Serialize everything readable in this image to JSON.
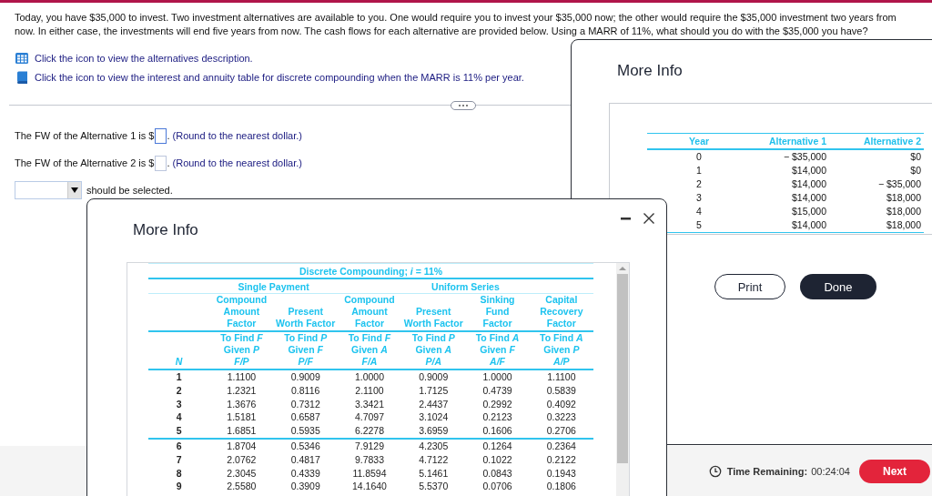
{
  "question": "Today, you have $35,000 to invest. Two investment alternatives are available to you. One would require you to invest your $35,000 now; the other would require the $35,000 investment two years from now. In either case, the investments will end five years from now. The cash flows for each alternative are provided below. Using a MARR of 11%, what should you do with the $35,000 you have?",
  "links": [
    {
      "kind": "table",
      "text": "Click the icon to view the alternatives description."
    },
    {
      "kind": "book",
      "text": "Click the icon to view the interest and annuity table for discrete compounding when the MARR is 11% per year."
    }
  ],
  "answers": [
    {
      "prefix": "The FW of the Alternative 1 is $",
      "suffix": ".",
      "hint": "(Round to the nearest dollar.)",
      "focused": true
    },
    {
      "prefix": "The FW of the Alternative 2 is $",
      "suffix": ".",
      "hint": "(Round to the nearest dollar.)",
      "focused": false
    }
  ],
  "selection": {
    "suffix": "should be selected."
  },
  "alternatives_dialog": {
    "title": "More Info",
    "columns": [
      "Year",
      "Alternative 1",
      "Alternative 2"
    ],
    "rows": [
      [
        "0",
        "− $35,000",
        "$0"
      ],
      [
        "1",
        "$14,000",
        "$0"
      ],
      [
        "2",
        "$14,000",
        "− $35,000"
      ],
      [
        "3",
        "$14,000",
        "$18,000"
      ],
      [
        "4",
        "$15,000",
        "$18,000"
      ],
      [
        "5",
        "$14,000",
        "$18,000"
      ]
    ],
    "buttons": [
      {
        "label": "Print",
        "kind": "outline"
      },
      {
        "label": "Done",
        "kind": "primary"
      }
    ]
  },
  "factor_dialog": {
    "title": "More Info",
    "caption": "Discrete Compounding; *i* = 11%",
    "groups": [
      {
        "label": "Single Payment"
      },
      {
        "label": "Uniform Series"
      }
    ],
    "n_label": "N",
    "columns": [
      {
        "name": [
          "Compound",
          "Amount",
          "Factor"
        ],
        "to_find": "To Find *F*",
        "given": "Given *P*",
        "symbol": "F/P"
      },
      {
        "name": [
          "Present",
          "Worth Factor"
        ],
        "to_find": "To Find *P*",
        "given": "Given *F*",
        "symbol": "P/F"
      },
      {
        "name": [
          "Compound",
          "Amount",
          "Factor"
        ],
        "to_find": "To Find *F*",
        "given": "Given *A*",
        "symbol": "F/A"
      },
      {
        "name": [
          "Present",
          "Worth Factor"
        ],
        "to_find": "To Find *P*",
        "given": "Given *A*",
        "symbol": "P/A"
      },
      {
        "name": [
          "Sinking",
          "Fund",
          "Factor"
        ],
        "to_find": "To Find *A*",
        "given": "Given *F*",
        "symbol": "A/F"
      },
      {
        "name": [
          "Capital",
          "Recovery",
          "Factor"
        ],
        "to_find": "To Find *A*",
        "given": "Given *P*",
        "symbol": "A/P"
      }
    ],
    "rows": [
      {
        "n": "1",
        "values": [
          "1.1100",
          "0.9009",
          "1.0000",
          "0.9009",
          "1.0000",
          "1.1100"
        ]
      },
      {
        "n": "2",
        "values": [
          "1.2321",
          "0.8116",
          "2.1100",
          "1.7125",
          "0.4739",
          "0.5839"
        ]
      },
      {
        "n": "3",
        "values": [
          "1.3676",
          "0.7312",
          "3.3421",
          "2.4437",
          "0.2992",
          "0.4092"
        ]
      },
      {
        "n": "4",
        "values": [
          "1.5181",
          "0.6587",
          "4.7097",
          "3.1024",
          "0.2123",
          "0.3223"
        ]
      },
      {
        "n": "5",
        "values": [
          "1.6851",
          "0.5935",
          "6.2278",
          "3.6959",
          "0.1606",
          "0.2706"
        ]
      },
      {
        "n": "6",
        "values": [
          "1.8704",
          "0.5346",
          "7.9129",
          "4.2305",
          "0.1264",
          "0.2364"
        ]
      },
      {
        "n": "7",
        "values": [
          "2.0762",
          "0.4817",
          "9.7833",
          "4.7122",
          "0.1022",
          "0.2122"
        ]
      },
      {
        "n": "8",
        "values": [
          "2.3045",
          "0.4339",
          "11.8594",
          "5.1461",
          "0.0843",
          "0.1943"
        ]
      },
      {
        "n": "9",
        "values": [
          "2.5580",
          "0.3909",
          "14.1640",
          "5.5370",
          "0.0706",
          "0.1806"
        ]
      }
    ]
  },
  "footer": {
    "time_label": "Time Remaining:",
    "time": "00:24:04",
    "next": "Next"
  }
}
